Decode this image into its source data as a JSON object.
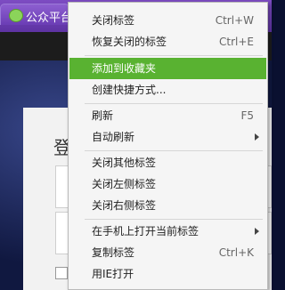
{
  "browser": {
    "tab_title": "公众平台"
  },
  "login": {
    "title": "登"
  },
  "context_menu": {
    "items": [
      {
        "label": "关闭标签",
        "shortcut": "Ctrl+W"
      },
      {
        "label": "恢复关闭的标签",
        "shortcut": "Ctrl+E"
      },
      {
        "label": "添加到收藏夹",
        "shortcut": "",
        "highlighted": true
      },
      {
        "label": "创建快捷方式...",
        "shortcut": ""
      },
      {
        "label": "刷新",
        "shortcut": "F5"
      },
      {
        "label": "自动刷新",
        "shortcut": "",
        "submenu": true
      },
      {
        "label": "关闭其他标签",
        "shortcut": ""
      },
      {
        "label": "关闭左侧标签",
        "shortcut": ""
      },
      {
        "label": "关闭右侧标签",
        "shortcut": ""
      },
      {
        "label": "在手机上打开当前标签",
        "shortcut": "",
        "submenu": true
      },
      {
        "label": "复制标签",
        "shortcut": "Ctrl+K"
      },
      {
        "label": "用IE打开",
        "shortcut": ""
      }
    ],
    "highlight_color": "#59b231"
  }
}
